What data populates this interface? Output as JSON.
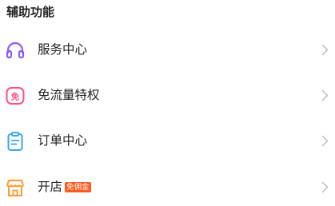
{
  "section": {
    "title": "辅助功能"
  },
  "items": [
    {
      "label": "服务中心",
      "icon": "headphones-icon",
      "icon_color": "#8a5cf5"
    },
    {
      "label": "免流量特权",
      "icon": "free-data-icon",
      "icon_color": "#ff4f7f",
      "icon_text": "免"
    },
    {
      "label": "订单中心",
      "icon": "clipboard-icon",
      "icon_color": "#3aa6ee"
    },
    {
      "label": "开店",
      "icon": "storefront-icon",
      "icon_color": "#ff9a2e",
      "badge": "免佣金",
      "badge_color": "#ff5a1f"
    }
  ],
  "chevron_color": "#b8b8b8"
}
